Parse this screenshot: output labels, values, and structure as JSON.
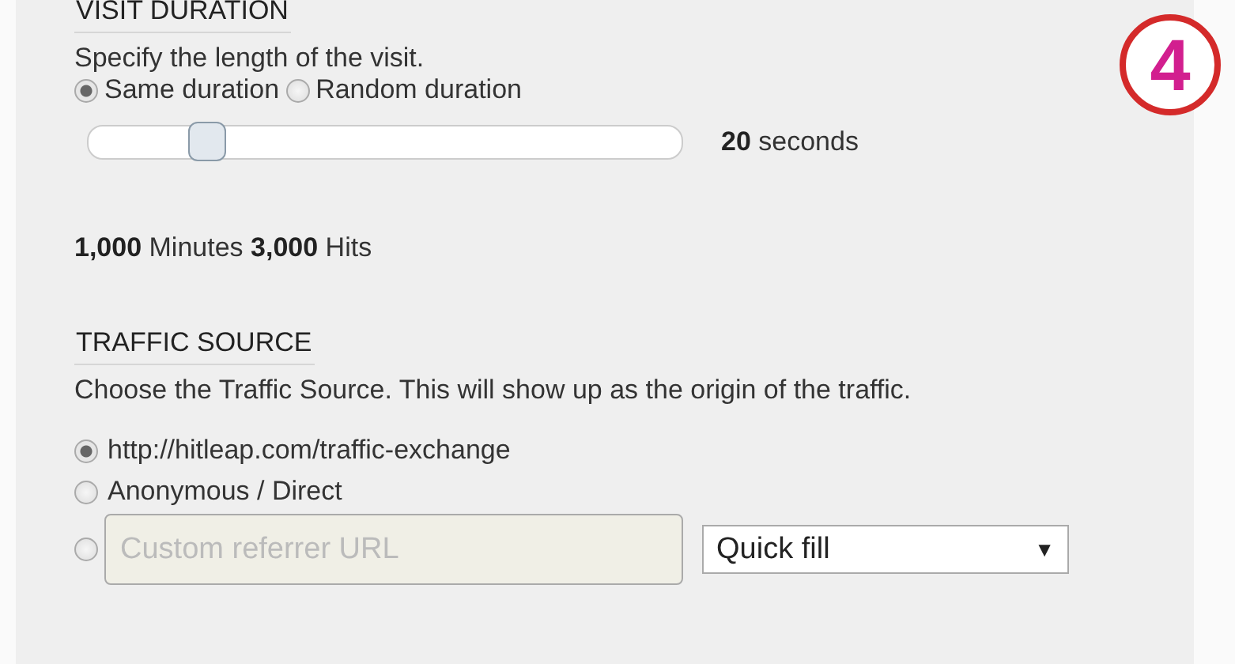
{
  "badge": {
    "text": "4"
  },
  "visit_duration": {
    "heading": "VISIT DURATION",
    "description": "Specify the length of the visit.",
    "options": [
      {
        "label": "Same duration",
        "selected": true
      },
      {
        "label": "Random duration",
        "selected": false
      }
    ],
    "slider": {
      "level": 0.2,
      "reading": "**20** seconds"
    },
    "stats": "**1,000** Minutes **3,000** Hits"
  },
  "traffic_source": {
    "heading": "TRAFFIC SOURCE",
    "description": "Choose the Traffic Source. This will show up as the origin of the traffic.",
    "options": [
      {
        "kind": "text",
        "label": "http://hitleap.com/traffic-exchange",
        "selected": true
      },
      {
        "kind": "text",
        "label": "Anonymous / Direct",
        "selected": false
      },
      {
        "kind": "input",
        "placeholder": "Custom referrer URL",
        "selected": false
      }
    ],
    "quick_fill": {
      "value": "Quick fill",
      "arrow": "▼"
    }
  }
}
